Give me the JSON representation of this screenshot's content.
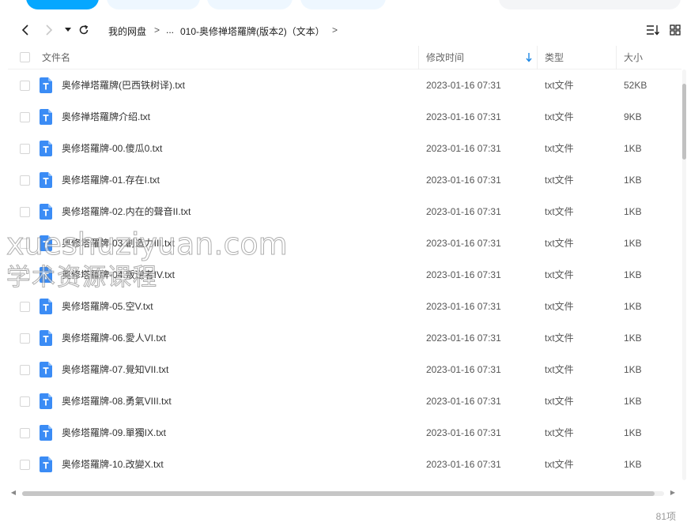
{
  "nav": {
    "breadcrumbs": [
      "我的网盘",
      "...",
      "010-奥修禅塔羅牌(版本2)（文本）"
    ],
    "separator": ">"
  },
  "table": {
    "columns": {
      "name": "文件名",
      "time": "修改时间",
      "type": "类型",
      "size": "大小"
    },
    "rows": [
      {
        "name": "奥修禅塔羅牌(巴西铁树译).txt",
        "time": "2023-01-16 07:31",
        "type": "txt文件",
        "size": "52KB"
      },
      {
        "name": "奥修禅塔羅牌介绍.txt",
        "time": "2023-01-16 07:31",
        "type": "txt文件",
        "size": "9KB"
      },
      {
        "name": "奥修塔羅牌-00.傻瓜0.txt",
        "time": "2023-01-16 07:31",
        "type": "txt文件",
        "size": "1KB"
      },
      {
        "name": "奥修塔羅牌-01.存在I.txt",
        "time": "2023-01-16 07:31",
        "type": "txt文件",
        "size": "1KB"
      },
      {
        "name": "奥修塔羅牌-02.内在的聲音II.txt",
        "time": "2023-01-16 07:31",
        "type": "txt文件",
        "size": "1KB"
      },
      {
        "name": "奥修塔羅牌-03.創造力III.txt",
        "time": "2023-01-16 07:31",
        "type": "txt文件",
        "size": "1KB"
      },
      {
        "name": "奥修塔羅牌-04.叛逆者IV.txt",
        "time": "2023-01-16 07:31",
        "type": "txt文件",
        "size": "1KB"
      },
      {
        "name": "奥修塔羅牌-05.空V.txt",
        "time": "2023-01-16 07:31",
        "type": "txt文件",
        "size": "1KB"
      },
      {
        "name": "奥修塔羅牌-06.愛人VI.txt",
        "time": "2023-01-16 07:31",
        "type": "txt文件",
        "size": "1KB"
      },
      {
        "name": "奥修塔羅牌-07.覺知VII.txt",
        "time": "2023-01-16 07:31",
        "type": "txt文件",
        "size": "1KB"
      },
      {
        "name": "奥修塔羅牌-08.勇氣VIII.txt",
        "time": "2023-01-16 07:31",
        "type": "txt文件",
        "size": "1KB"
      },
      {
        "name": "奥修塔羅牌-09.單獨IX.txt",
        "time": "2023-01-16 07:31",
        "type": "txt文件",
        "size": "1KB"
      },
      {
        "name": "奥修塔羅牌-10.改變X.txt",
        "time": "2023-01-16 07:31",
        "type": "txt文件",
        "size": "1KB"
      }
    ]
  },
  "footer": {
    "count": "81项"
  },
  "watermark": {
    "line1": "xueshuziyuan.com",
    "line2": "学术资源课程"
  },
  "colors": {
    "accent": "#06a7ff",
    "file_icon": "#3b8cf5",
    "sort_arrow": "#1e88e5"
  },
  "icons": {
    "back": "chevron-left-icon",
    "forward": "chevron-right-icon",
    "history": "caret-down-icon",
    "refresh": "refresh-icon",
    "sort": "sort-icon",
    "view": "grid-view-icon",
    "file": "txt-file-icon"
  }
}
